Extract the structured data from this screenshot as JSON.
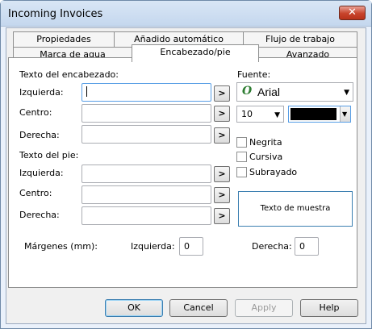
{
  "window": {
    "title": "Incoming Invoices",
    "close_glyph": "✕"
  },
  "tabs_row1": [
    {
      "label": "Propiedades"
    },
    {
      "label": "Añadido automático"
    },
    {
      "label": "Flujo de trabajo"
    }
  ],
  "tabs_row2": [
    {
      "label": "Marca de agua"
    },
    {
      "label": "Encabezado/pie"
    },
    {
      "label": "Avanzado"
    }
  ],
  "header": {
    "section_label": "Texto del encabezado:",
    "left_label": "Izquierda:",
    "left_value": "",
    "center_label": "Centro:",
    "center_value": "",
    "right_label": "Derecha:",
    "right_value": ""
  },
  "footer": {
    "section_label": "Texto del pie:",
    "left_label": "Izquierda:",
    "left_value": "",
    "center_label": "Centro:",
    "center_value": "",
    "right_label": "Derecha:",
    "right_value": ""
  },
  "insert_button_label": ">",
  "font": {
    "section_label": "Fuente:",
    "family_icon_glyph": "O",
    "family": "Arial",
    "size": "10",
    "color": "#000000",
    "dropdown_glyph": "▼",
    "bold_label": "Negrita",
    "italic_label": "Cursiva",
    "underline_label": "Subrayado",
    "sample_text": "Texto de muestra"
  },
  "margins": {
    "label": "Márgenes (mm):",
    "left_label": "Izquierda:",
    "left_value": "0",
    "right_label": "Derecha:",
    "right_value": "0"
  },
  "buttons": {
    "ok": "OK",
    "cancel": "Cancel",
    "apply": "Apply",
    "help": "Help"
  },
  "colors": {
    "accent": "#3c7fb1",
    "close": "#c7432b",
    "titlebar": "#c4d7ee"
  }
}
